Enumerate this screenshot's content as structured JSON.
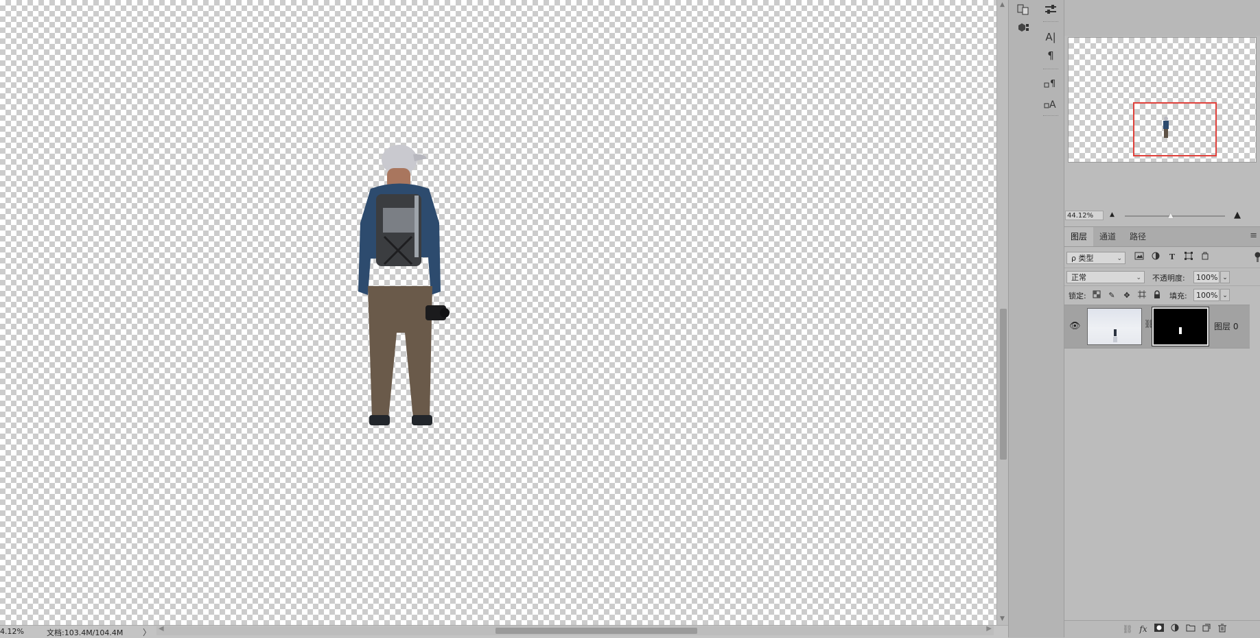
{
  "canvas": {
    "subject": "person-cutout"
  },
  "status_bar": {
    "zoom": "4.12%",
    "doc": "文档:103.4M/104.4M",
    "more": "〉"
  },
  "left_dock": {
    "icons": [
      "arrange-documents-icon",
      "3d-icon"
    ]
  },
  "mid_dock": {
    "icons": [
      "properties-icon",
      "character-icon",
      "paragraph-icon",
      "paragraph-styles-icon",
      "character-styles-icon"
    ],
    "glyphs": [
      "⚟",
      "A|",
      "¶",
      "¶",
      "A"
    ]
  },
  "navigator": {
    "zoom_value": "44.12%",
    "frame_color": "#e0403a"
  },
  "layers_panel": {
    "tabs": [
      {
        "label": "图层",
        "active": true
      },
      {
        "label": "通道",
        "active": false
      },
      {
        "label": "路径",
        "active": false
      }
    ],
    "filter": {
      "label": "ρ 类型"
    },
    "blend": {
      "mode": "正常",
      "opacity_label": "不透明度:",
      "opacity": "100%"
    },
    "lock": {
      "label": "锁定:",
      "fill_label": "填充:",
      "fill": "100%"
    },
    "layers": [
      {
        "name": "图层 0",
        "visible": true,
        "has_mask": true
      }
    ]
  }
}
